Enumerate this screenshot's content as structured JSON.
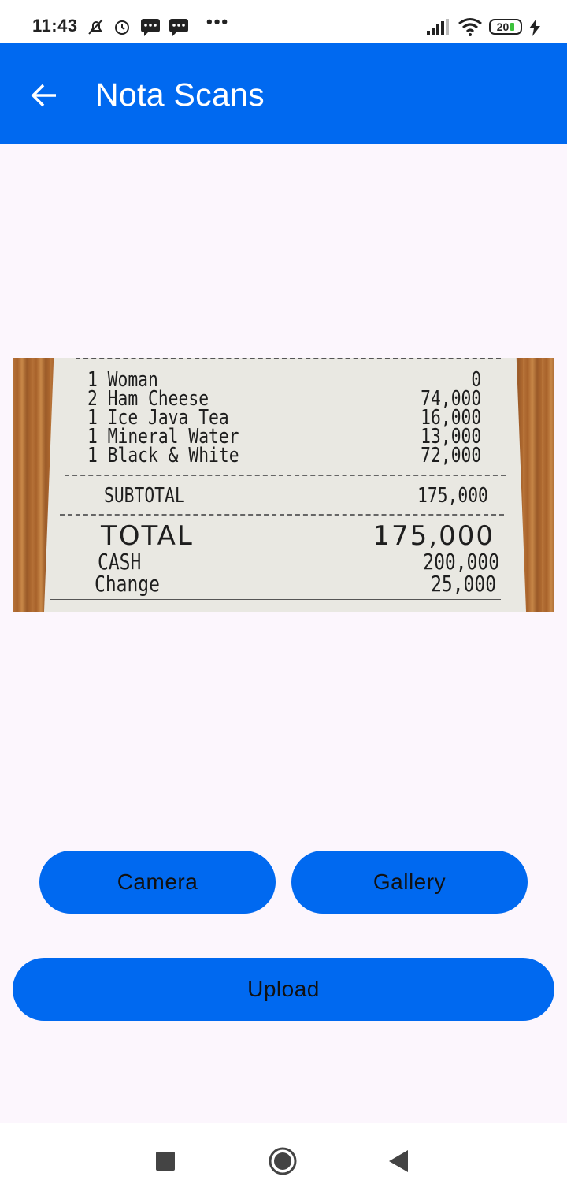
{
  "status_bar": {
    "time": "11:43",
    "battery": "20",
    "more": "•••"
  },
  "app_bar": {
    "title": "Nota Scans"
  },
  "receipt": {
    "items": [
      {
        "text": "1 Woman",
        "amount": "0"
      },
      {
        "text": "2 Ham Cheese",
        "amount": "74,000"
      },
      {
        "text": "1 Ice Java Tea",
        "amount": "16,000"
      },
      {
        "text": "1 Mineral Water",
        "amount": "13,000"
      },
      {
        "text": "1 Black & White",
        "amount": "72,000"
      }
    ],
    "subtotal_label": "SUBTOTAL",
    "subtotal_value": "175,000",
    "total_label": "TOTAL",
    "total_value": "175,000",
    "cash_label": "CASH",
    "cash_value": "200,000",
    "change_label": "Change",
    "change_value": "25,000"
  },
  "buttons": {
    "camera": "Camera",
    "gallery": "Gallery",
    "upload": "Upload"
  },
  "colors": {
    "primary": "#0069f0",
    "background": "#fcf6fd"
  }
}
